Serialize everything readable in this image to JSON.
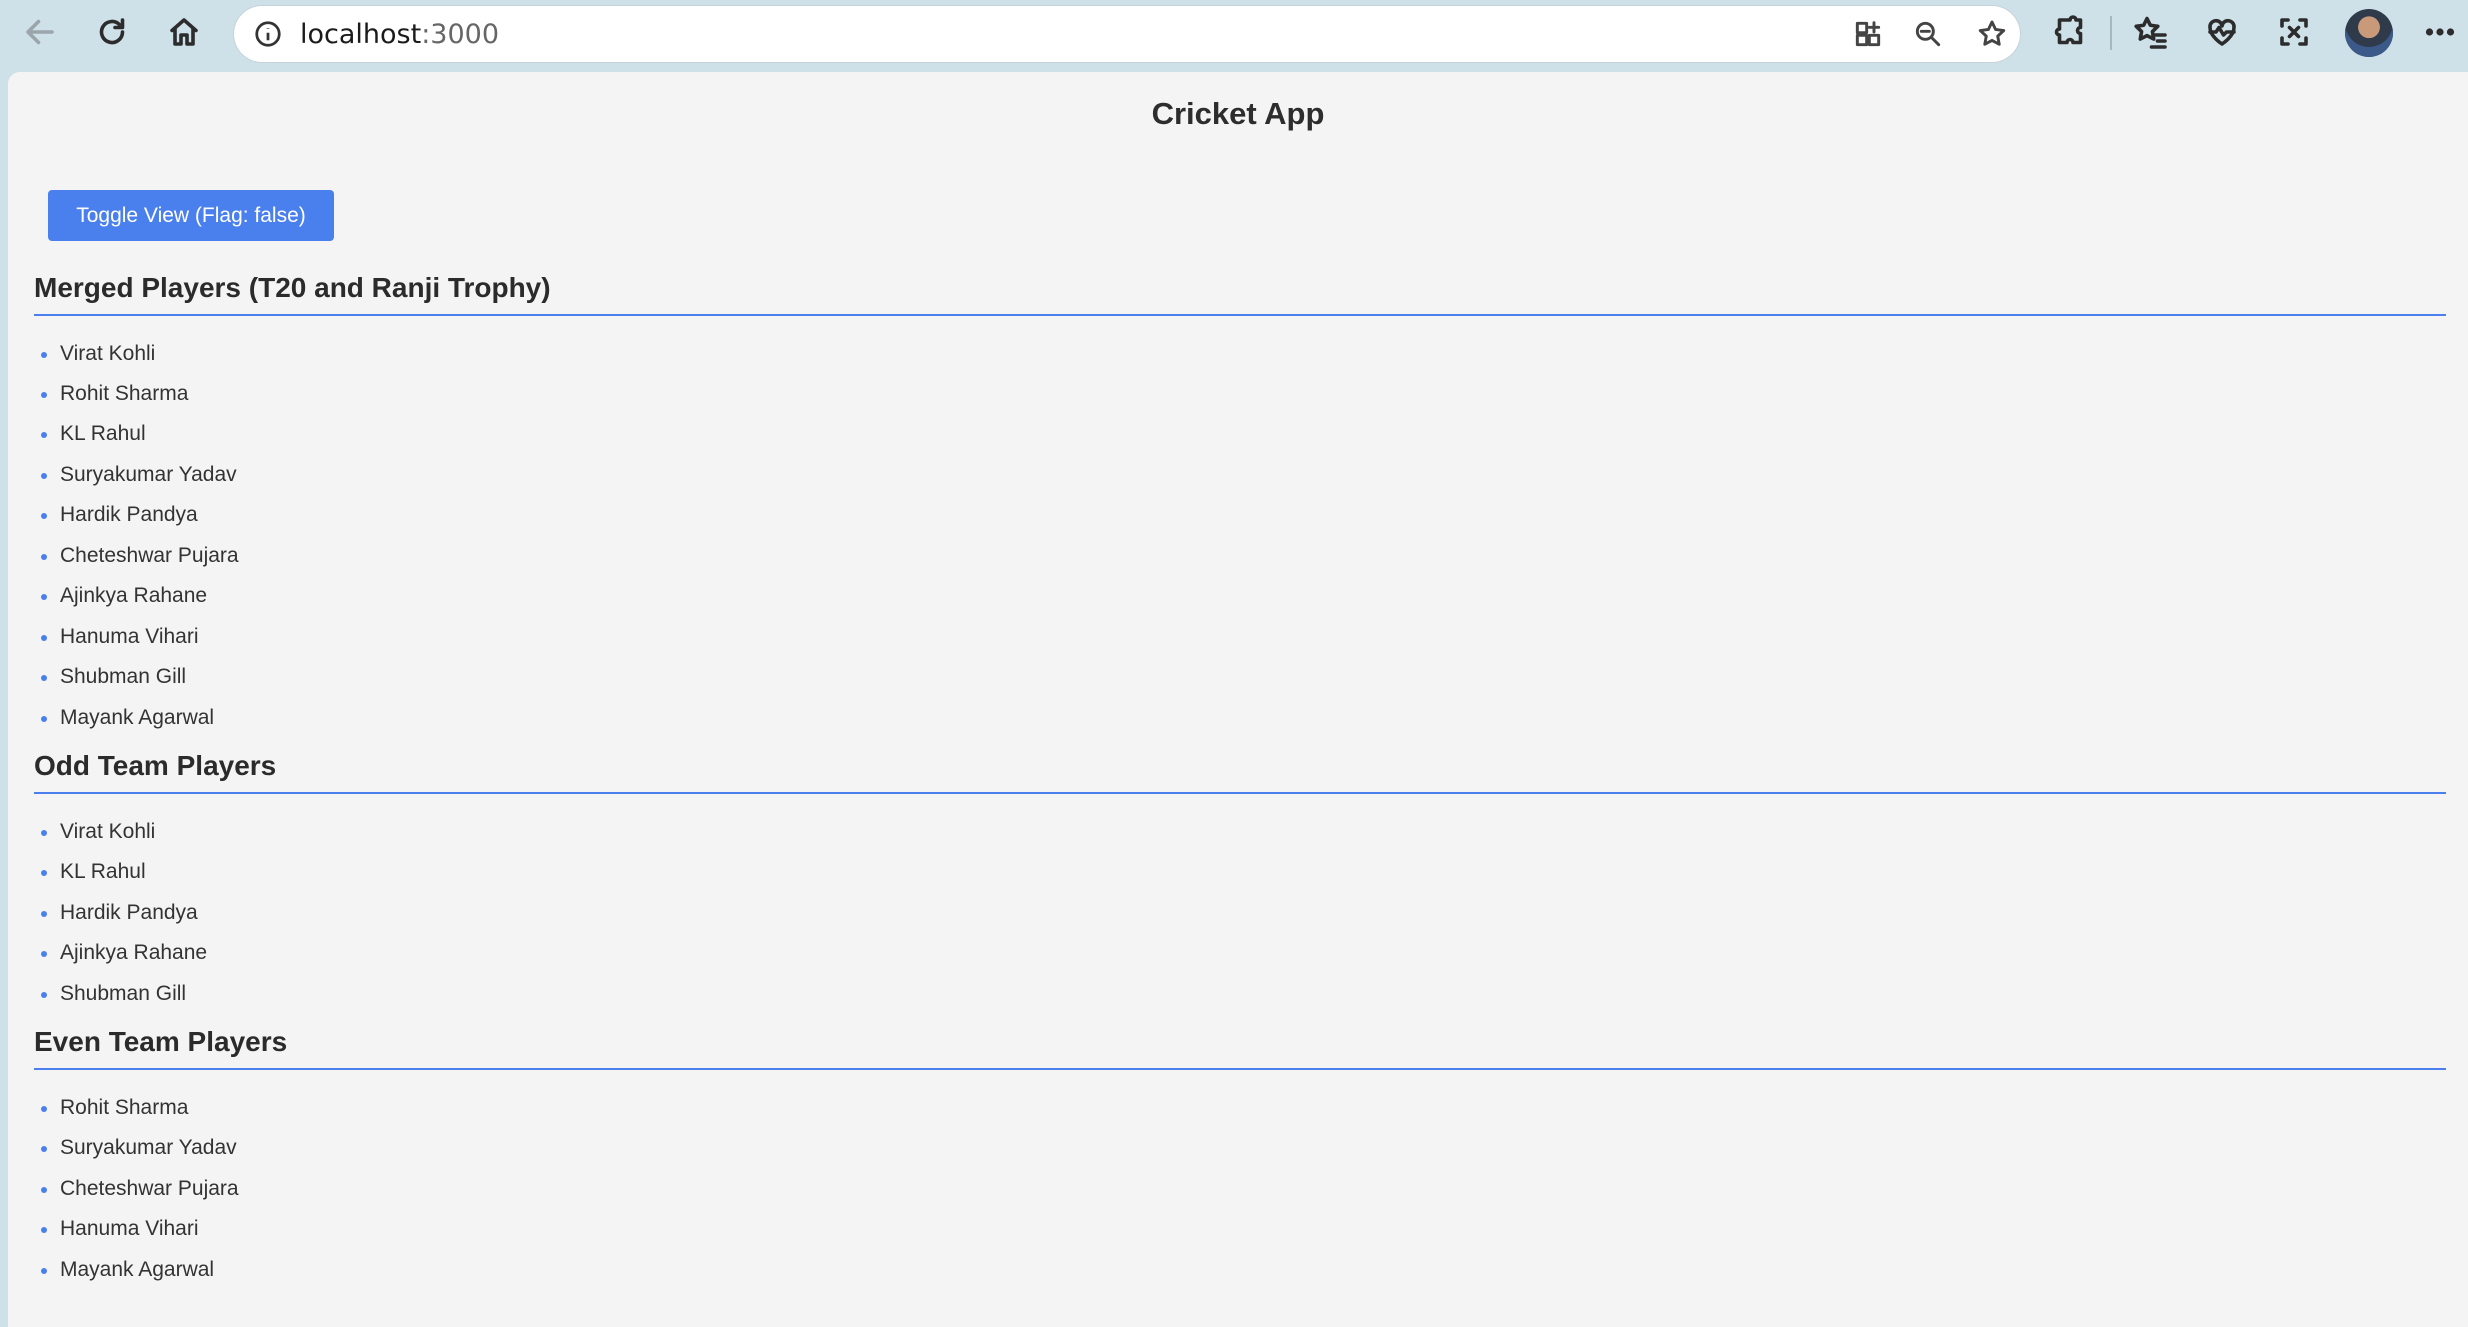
{
  "browser": {
    "url_host": "localhost",
    "url_port": ":3000",
    "icons": {
      "back": "back-arrow-icon",
      "refresh": "refresh-icon",
      "home": "home-icon",
      "info": "info-icon",
      "app_available": "app-available-icon",
      "zoom_out": "zoom-out-icon",
      "favorite": "star-icon",
      "extensions": "puzzle-icon",
      "favorites": "favorites-icon",
      "health": "heartbeat-icon",
      "screenshot": "web-capture-icon",
      "profile": "avatar",
      "menu": "more-icon"
    }
  },
  "page": {
    "title": "Cricket App",
    "toggle_button": "Toggle View (Flag: false)",
    "accent_color": "#4a7fee",
    "sections": [
      {
        "heading": "Merged Players (T20 and Ranji Trophy)",
        "players": [
          "Virat Kohli",
          "Rohit Sharma",
          "KL Rahul",
          "Suryakumar Yadav",
          "Hardik Pandya",
          "Cheteshwar Pujara",
          "Ajinkya Rahane",
          "Hanuma Vihari",
          "Shubman Gill",
          "Mayank Agarwal"
        ]
      },
      {
        "heading": "Odd Team Players",
        "players": [
          "Virat Kohli",
          "KL Rahul",
          "Hardik Pandya",
          "Ajinkya Rahane",
          "Shubman Gill"
        ]
      },
      {
        "heading": "Even Team Players",
        "players": [
          "Rohit Sharma",
          "Suryakumar Yadav",
          "Cheteshwar Pujara",
          "Hanuma Vihari",
          "Mayank Agarwal"
        ]
      }
    ]
  }
}
